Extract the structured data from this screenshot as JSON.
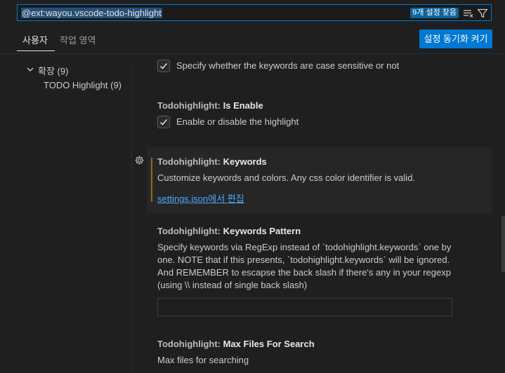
{
  "search": {
    "value": "@ext:wayou.vscode-todo-highlight",
    "result_count": "9개 설정 찾음"
  },
  "tabs": {
    "user": "사용자",
    "workspace": "작업 영역"
  },
  "sync_button": "설정 동기화 켜기",
  "toc": {
    "extensions": "확장 (9)",
    "todo_highlight": "TODO Highlight (9)"
  },
  "settings": {
    "case_sensitive": {
      "description": "Specify whether the keywords are case sensitive or not",
      "checked": true
    },
    "is_enable": {
      "category": "Todohighlight: ",
      "name": "Is Enable",
      "description": "Enable or disable the highlight",
      "checked": true
    },
    "keywords": {
      "category": "Todohighlight: ",
      "name": "Keywords",
      "description": "Customize keywords and colors. Any css color identifier is valid.",
      "link": "settings.json에서 편집"
    },
    "keywords_pattern": {
      "category": "Todohighlight: ",
      "name": "Keywords Pattern",
      "description_lines": [
        "Specify keywords via RegExp instead of `todohighlight.keywords` one by",
        "one. NOTE that if this presents, `todohighlight.keywords` will be ignored.",
        "And REMEMBER to escapse the back slash if there's any in your regexp",
        "(using \\\\ instead of single back slash)"
      ],
      "value": ""
    },
    "max_files": {
      "category": "Todohighlight: ",
      "name": "Max Files For Search",
      "description": "Max files for searching"
    }
  },
  "colors": {
    "accent": "#0078d4",
    "badge": "#0e639c",
    "link": "#4daafc",
    "modified_bar": "#8a6d2a"
  }
}
